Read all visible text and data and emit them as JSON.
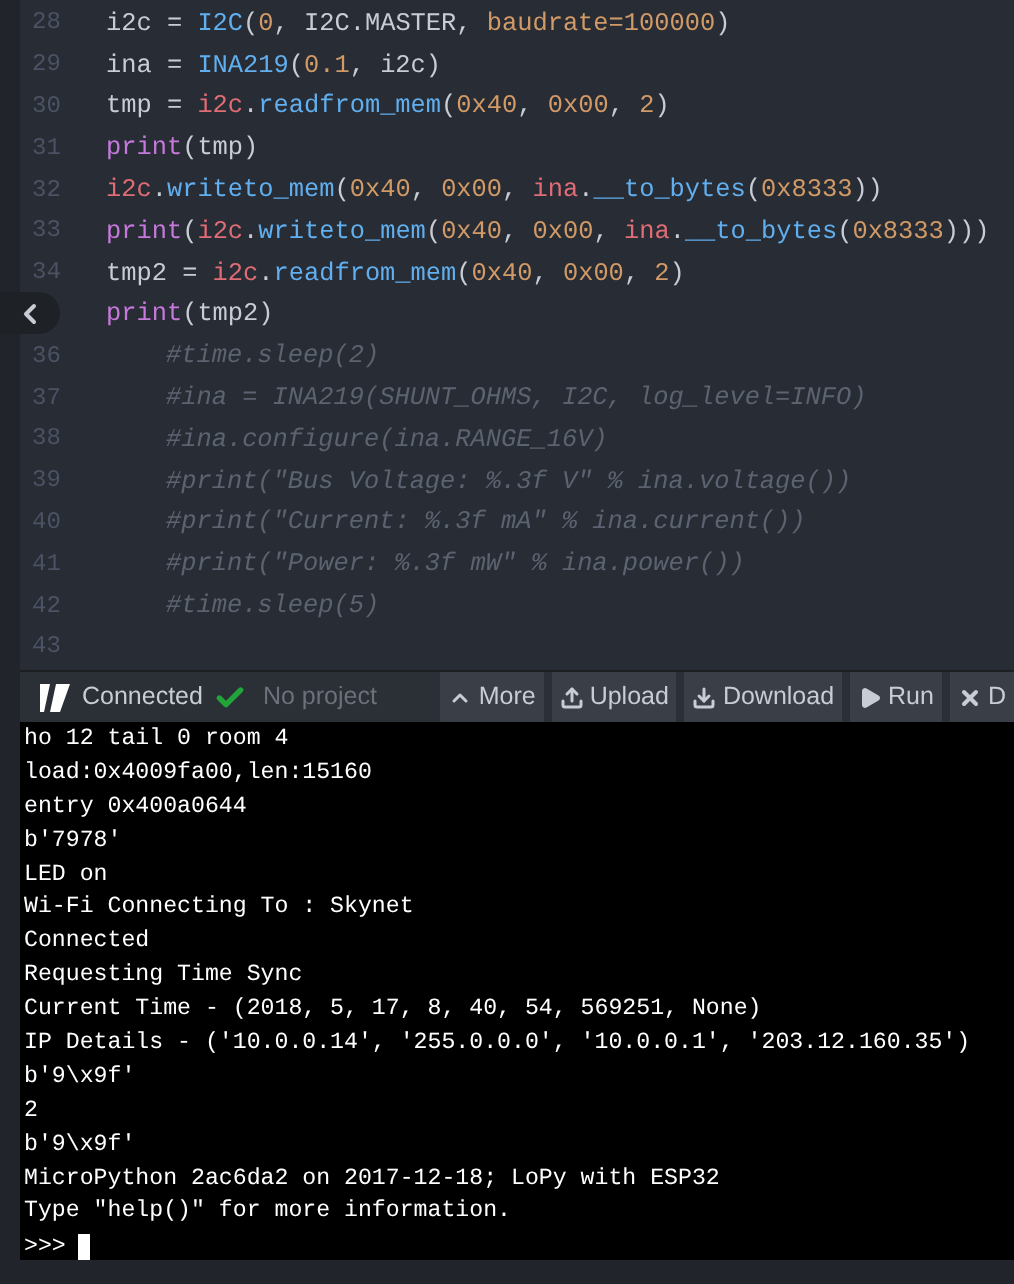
{
  "editor": {
    "lines": [
      {
        "number": "28",
        "indented": false,
        "tokens": [
          {
            "kind": "plain",
            "text": "i2c = "
          },
          {
            "kind": "cls",
            "text": "I2C"
          },
          {
            "kind": "plain",
            "text": "("
          },
          {
            "kind": "num",
            "text": "0"
          },
          {
            "kind": "plain",
            "text": ", I2C.MASTER, "
          },
          {
            "kind": "num",
            "text": "baudrate=100000"
          },
          {
            "kind": "plain",
            "text": ")"
          }
        ]
      },
      {
        "number": "29",
        "indented": false,
        "tokens": [
          {
            "kind": "plain",
            "text": "ina = "
          },
          {
            "kind": "cls",
            "text": "INA219"
          },
          {
            "kind": "plain",
            "text": "("
          },
          {
            "kind": "num",
            "text": "0.1"
          },
          {
            "kind": "plain",
            "text": ", i2c)"
          }
        ]
      },
      {
        "number": "30",
        "indented": false,
        "tokens": [
          {
            "kind": "plain",
            "text": "tmp = "
          },
          {
            "kind": "obj",
            "text": "i2c"
          },
          {
            "kind": "plain",
            "text": "."
          },
          {
            "kind": "cls",
            "text": "readfrom_mem"
          },
          {
            "kind": "plain",
            "text": "("
          },
          {
            "kind": "num",
            "text": "0x40"
          },
          {
            "kind": "plain",
            "text": ", "
          },
          {
            "kind": "num",
            "text": "0x00"
          },
          {
            "kind": "plain",
            "text": ", "
          },
          {
            "kind": "num",
            "text": "2"
          },
          {
            "kind": "plain",
            "text": ")"
          }
        ]
      },
      {
        "number": "31",
        "indented": false,
        "tokens": [
          {
            "kind": "fn",
            "text": "print"
          },
          {
            "kind": "plain",
            "text": "(tmp)"
          }
        ]
      },
      {
        "number": "32",
        "indented": false,
        "tokens": [
          {
            "kind": "obj",
            "text": "i2c"
          },
          {
            "kind": "plain",
            "text": "."
          },
          {
            "kind": "cls",
            "text": "writeto_mem"
          },
          {
            "kind": "plain",
            "text": "("
          },
          {
            "kind": "num",
            "text": "0x40"
          },
          {
            "kind": "plain",
            "text": ", "
          },
          {
            "kind": "num",
            "text": "0x00"
          },
          {
            "kind": "plain",
            "text": ", "
          },
          {
            "kind": "obj",
            "text": "ina"
          },
          {
            "kind": "plain",
            "text": "."
          },
          {
            "kind": "cls",
            "text": "__to_bytes"
          },
          {
            "kind": "plain",
            "text": "("
          },
          {
            "kind": "num",
            "text": "0x8333"
          },
          {
            "kind": "plain",
            "text": "))"
          }
        ]
      },
      {
        "number": "33",
        "indented": false,
        "tokens": [
          {
            "kind": "fn",
            "text": "print"
          },
          {
            "kind": "plain",
            "text": "("
          },
          {
            "kind": "obj",
            "text": "i2c"
          },
          {
            "kind": "plain",
            "text": "."
          },
          {
            "kind": "cls",
            "text": "writeto_mem"
          },
          {
            "kind": "plain",
            "text": "("
          },
          {
            "kind": "num",
            "text": "0x40"
          },
          {
            "kind": "plain",
            "text": ", "
          },
          {
            "kind": "num",
            "text": "0x00"
          },
          {
            "kind": "plain",
            "text": ", "
          },
          {
            "kind": "obj",
            "text": "ina"
          },
          {
            "kind": "plain",
            "text": "."
          },
          {
            "kind": "cls",
            "text": "__to_bytes"
          },
          {
            "kind": "plain",
            "text": "("
          },
          {
            "kind": "num",
            "text": "0x8333"
          },
          {
            "kind": "plain",
            "text": ")))"
          }
        ]
      },
      {
        "number": "34",
        "indented": false,
        "tokens": [
          {
            "kind": "plain",
            "text": "tmp2 = "
          },
          {
            "kind": "obj",
            "text": "i2c"
          },
          {
            "kind": "plain",
            "text": "."
          },
          {
            "kind": "cls",
            "text": "readfrom_mem"
          },
          {
            "kind": "plain",
            "text": "("
          },
          {
            "kind": "num",
            "text": "0x40"
          },
          {
            "kind": "plain",
            "text": ", "
          },
          {
            "kind": "num",
            "text": "0x00"
          },
          {
            "kind": "plain",
            "text": ", "
          },
          {
            "kind": "num",
            "text": "2"
          },
          {
            "kind": "plain",
            "text": ")"
          }
        ]
      },
      {
        "indented": false,
        "tokens": [
          {
            "kind": "fn",
            "text": "print"
          },
          {
            "kind": "plain",
            "text": "(tmp2)"
          }
        ]
      },
      {
        "number": "36",
        "indented": true,
        "tokens": [
          {
            "kind": "comment",
            "text": "#time.sleep(2)"
          }
        ]
      },
      {
        "number": "37",
        "indented": true,
        "tokens": [
          {
            "kind": "comment",
            "text": "#ina = INA219(SHUNT_OHMS, I2C, log_level=INFO)"
          }
        ]
      },
      {
        "number": "38",
        "indented": true,
        "tokens": [
          {
            "kind": "comment",
            "text": "#ina.configure(ina.RANGE_16V)"
          }
        ]
      },
      {
        "number": "39",
        "indented": true,
        "tokens": [
          {
            "kind": "comment",
            "text": "#print(\"Bus Voltage: %.3f V\" % ina.voltage())"
          }
        ]
      },
      {
        "number": "40",
        "indented": true,
        "tokens": [
          {
            "kind": "comment",
            "text": "#print(\"Current: %.3f mA\" % ina.current())"
          }
        ]
      },
      {
        "number": "41",
        "indented": true,
        "tokens": [
          {
            "kind": "comment",
            "text": "#print(\"Power: %.3f mW\" % ina.power())"
          }
        ]
      },
      {
        "number": "42",
        "indented": true,
        "tokens": [
          {
            "kind": "comment",
            "text": "#time.sleep(5)"
          }
        ]
      },
      {
        "number": "43"
      }
    ]
  },
  "toolbar": {
    "status": "Connected",
    "project": "No project",
    "buttons": [
      {
        "kind": "more",
        "label": "More"
      },
      {
        "kind": "upload",
        "label": "Upload"
      },
      {
        "kind": "download",
        "label": "Download"
      },
      {
        "kind": "run",
        "label": "Run"
      },
      {
        "kind": "disconnect",
        "label": "D"
      }
    ]
  },
  "terminal": {
    "lines": [
      "ho 12 tail 0 room 4",
      "load:0x4009fa00,len:15160",
      "entry 0x400a0644",
      "b'7978'",
      "LED on",
      "Wi-Fi Connecting To : Skynet",
      "Connected",
      "Requesting Time Sync",
      "Current Time - (2018, 5, 17, 8, 40, 54, 569251, None)",
      "IP Details - ('10.0.0.14', '255.0.0.0', '10.0.0.1', '203.12.160.35')",
      "b'9\\x9f'",
      "2",
      "b'9\\x9f'",
      "MicroPython 2ac6da2 on 2017-12-18; LoPy with ESP32",
      "Type \"help()\" for more information."
    ],
    "prompt": ">>>"
  }
}
